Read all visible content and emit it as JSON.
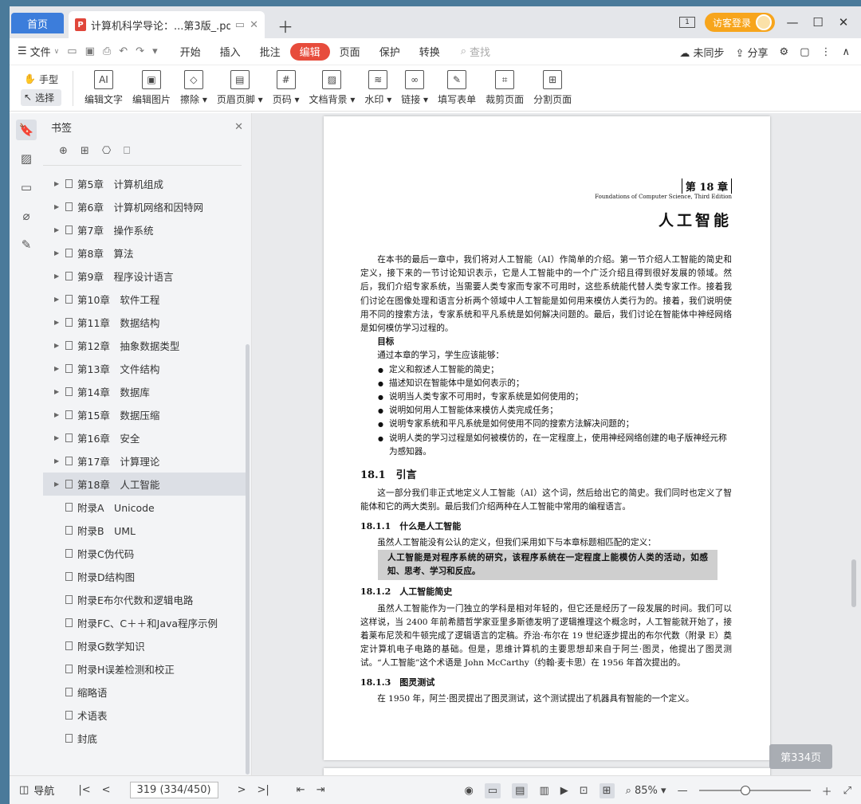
{
  "titlebar": {
    "home_tab": "首页",
    "doc_tab": "计算机科学导论：...第3版_.pdf",
    "login_label": "访客登录"
  },
  "menubar": {
    "file_label": "文件",
    "items": [
      "开始",
      "插入",
      "批注",
      "编辑",
      "页面",
      "保护",
      "转换"
    ],
    "active": "编辑",
    "search_placeholder": "查找",
    "sync_label": "未同步",
    "share_label": "分享"
  },
  "ribbon": {
    "hand_label": "手型",
    "select_label": "选择",
    "tools": [
      {
        "label": "编辑文字",
        "icon": "AI"
      },
      {
        "label": "编辑图片",
        "icon": "▣"
      },
      {
        "label": "擦除 ▾",
        "icon": "◇"
      },
      {
        "label": "页眉页脚 ▾",
        "icon": "▤"
      },
      {
        "label": "页码 ▾",
        "icon": "#"
      },
      {
        "label": "文档背景 ▾",
        "icon": "▨"
      },
      {
        "label": "水印 ▾",
        "icon": "≋"
      },
      {
        "label": "链接 ▾",
        "icon": "∞"
      },
      {
        "label": "填写表单",
        "icon": "✎"
      },
      {
        "label": "裁剪页面",
        "icon": "⌗"
      },
      {
        "label": "分割页面",
        "icon": "⊞"
      }
    ]
  },
  "bookmarks": {
    "title": "书签",
    "items": [
      {
        "label": "第5章　计算机组成",
        "has_children": true
      },
      {
        "label": "第6章　计算机网络和因特网",
        "has_children": true
      },
      {
        "label": "第7章　操作系统",
        "has_children": true
      },
      {
        "label": "第8章　算法",
        "has_children": true
      },
      {
        "label": "第9章　程序设计语言",
        "has_children": true
      },
      {
        "label": "第10章　软件工程",
        "has_children": true
      },
      {
        "label": "第11章　数据结构",
        "has_children": true
      },
      {
        "label": "第12章　抽象数据类型",
        "has_children": true
      },
      {
        "label": "第13章　文件结构",
        "has_children": true
      },
      {
        "label": "第14章　数据库",
        "has_children": true
      },
      {
        "label": "第15章　数据压缩",
        "has_children": true
      },
      {
        "label": "第16章　安全",
        "has_children": true
      },
      {
        "label": "第17章　计算理论",
        "has_children": true
      },
      {
        "label": "第18章　人工智能",
        "has_children": true,
        "selected": true
      },
      {
        "label": "附录A　Unicode",
        "has_children": false
      },
      {
        "label": "附录B　UML",
        "has_children": false
      },
      {
        "label": "附录C伪代码",
        "has_children": false
      },
      {
        "label": "附录D结构图",
        "has_children": false
      },
      {
        "label": "附录E布尔代数和逻辑电路",
        "has_children": false
      },
      {
        "label": "附录FC、C＋＋和Java程序示例",
        "has_children": false
      },
      {
        "label": "附录G数学知识",
        "has_children": false
      },
      {
        "label": "附录H误差检测和校正",
        "has_children": false
      },
      {
        "label": "缩略语",
        "has_children": false
      },
      {
        "label": "术语表",
        "has_children": false
      },
      {
        "label": "封底",
        "has_children": false
      }
    ]
  },
  "page": {
    "chapter_num": "第 18 章",
    "chapter_sub": "Foundations of Computer Science, Third Edition",
    "chapter_title": "人工智能",
    "intro": "在本书的最后一章中，我们将对人工智能（AI）作简单的介绍。第一节介绍人工智能的简史和定义，接下来的一节讨论知识表示，它是人工智能中的一个广泛介绍且得到很好发展的领域。然后，我们介绍专家系统，当需要人类专家而专家不可用时，这些系统能代替人类专家工作。接着我们讨论在图像处理和语言分析两个领域中人工智能是如何用来模仿人类行为的。接着，我们说明使用不同的搜索方法，专家系统和平凡系统是如何解决问题的。最后，我们讨论在智能体中神经网络是如何模仿学习过程的。",
    "goals_title": "目标",
    "goals_intro": "通过本章的学习，学生应该能够：",
    "goals": [
      "定义和叙述人工智能的简史；",
      "描述知识在智能体中是如何表示的；",
      "说明当人类专家不可用时，专家系统是如何使用的；",
      "说明如何用人工智能体来模仿人类完成任务；",
      "说明专家系统和平凡系统是如何使用不同的搜索方法解决问题的；",
      "说明人类的学习过程是如何被模仿的，在一定程度上，使用神经网络创建的电子版神经元称为感知器。"
    ],
    "s181_title": "18.1　引言",
    "s181_text": "这一部分我们非正式地定义人工智能（AI）这个词，然后给出它的简史。我们同时也定义了智能体和它的两大类别。最后我们介绍两种在人工智能中常用的编程语言。",
    "s1811_title": "18.1.1　什么是人工智能",
    "s1811_text": "虽然人工智能没有公认的定义，但我们采用如下与本章标题相匹配的定义：",
    "s1811_def": "人工智能是对程序系统的研究，该程序系统在一定程度上能模仿人类的活动，如感知、思考、学习和反应。",
    "s1812_title": "18.1.2　人工智能简史",
    "s1812_text": "虽然人工智能作为一门独立的学科是相对年轻的，但它还是经历了一段发展的时间。我们可以这样说，当 2400 年前希腊哲学家亚里多斯德发明了逻辑推理这个概念时，人工智能就开始了，接着莱布尼茨和牛顿完成了逻辑语言的定稿。乔治·布尔在 19 世纪逐步提出的布尔代数（附录 E）奠定计算机电子电路的基础。但是，思维计算机的主要思想却来自于阿兰·图灵，他提出了图灵测试。“人工智能”这个术语是 John McCarthy（约翰·麦卡思）在 1956 年首次提出的。",
    "s1813_title": "18.1.3　图灵测试",
    "s1813_text": "在 1950 年，阿兰·图灵提出了图灵测试，这个测试提出了机器具有智能的一个定义。",
    "badge": "第334页"
  },
  "statusbar": {
    "nav_label": "导航",
    "page_value": "319 (334/450)",
    "zoom": "85%"
  }
}
